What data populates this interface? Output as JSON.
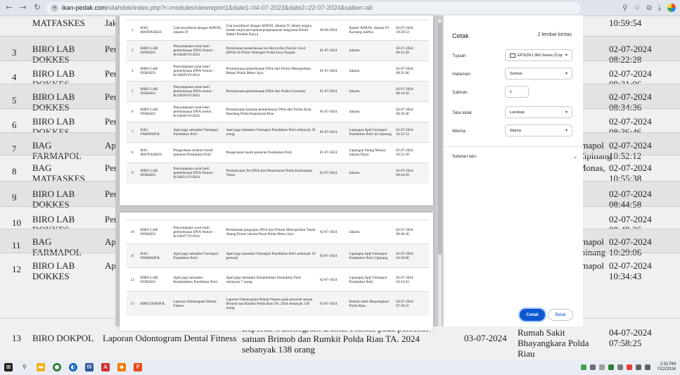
{
  "browser": {
    "url_host": "ikan-pedak.com",
    "url_path": "/silahdok/index.php?r=modules/viewreport1&date1=04-07-2023&date2=22-07-2024&satker=all",
    "icons": [
      "back-icon",
      "forward-icon",
      "reload-icon",
      "site-settings-icon",
      "zoom-icon",
      "bookmark-star-icon",
      "extensions-icon",
      "download-icon"
    ]
  },
  "background_table": {
    "rows": [
      {
        "no": "",
        "unit": "MATFASKES",
        "stub": "Jak",
        "loc": "",
        "date": "10:59:54"
      },
      {
        "no": "3",
        "unit": "BIRO LAB DOKKES",
        "stub": "Per DN",
        "loc": "",
        "date": "02-07-2024 08:22:28"
      },
      {
        "no": "4",
        "unit": "BIRO LAB DOKKES",
        "stub": "Per DN",
        "loc": "",
        "date": "02-07-2024 08:31:06"
      },
      {
        "no": "5",
        "unit": "BIRO LAB DOKKES",
        "stub": "Per DN",
        "loc": "",
        "date": "02-07-2024 08:34:36"
      },
      {
        "no": "6",
        "unit": "BIRO LAB DOKKES",
        "stub": "Per DN",
        "loc": "",
        "date": "02-07-2024 08:36:46"
      },
      {
        "no": "7",
        "unit": "BAG FARMAPOL",
        "stub": "Ap Pus",
        "loc": "rmapol Cipinang",
        "date": "02-07-2024 10:52:12"
      },
      {
        "no": "8",
        "unit": "BAG MATFASKES",
        "stub": "Per Pus",
        "loc": "Monas,",
        "date": "02-07-2024 10:55:38"
      },
      {
        "no": "9",
        "unit": "BIRO LAB DOKKES",
        "stub": "Per DN",
        "loc": "",
        "date": "02-07-2024 08:44:58"
      },
      {
        "no": "10",
        "unit": "BIRO LAB DOKKES",
        "stub": "Per DN",
        "loc": "",
        "date": "02-07-2024 08:48:36"
      },
      {
        "no": "11",
        "unit": "BAG FARMAPOL",
        "stub": "Ap Pus",
        "loc": "rmapol ipinang",
        "date": "02-07-2024 10:29:06"
      },
      {
        "no": "12",
        "unit": "BIRO LAB DOKKES",
        "stub": "Ap Pus",
        "loc": "rmapol",
        "date": "02-07-2024 10:34:43"
      }
    ],
    "last_row": {
      "no": "13",
      "unit": "BIRO DOKPOL",
      "kegiatan": "Laporan Odontogram Dental Fitness",
      "desc": "Laporan Odontogram Dental Fitness pada personel satuan Brimob dan Rumkit Polda Riau TA. 2024 sebanyak 138 orang",
      "tgl": "03-07-2024",
      "loc": "Rumah Sakit Bhayangkara Polda Riau",
      "date": "04-07-2024 07:58:25"
    }
  },
  "preview": {
    "page1_rows": [
      {
        "no": "2",
        "unit": "BAG MATFASKES",
        "keg": "Giat koordinasi dengan KPKNL Jakarta IV",
        "desc": "Giat koordinasi dengan KPKNL Jakarta IV dalam rangka tindak lanjut percepatan penghapusan bangunan Klinik Satkes Pondok Karya",
        "tgl": "28-06-2024",
        "loc": "Kantor KPKNL Jakarta IV- Kwitang JakPus",
        "ts": "02-07-2024 10:59:54"
      },
      {
        "no": "3",
        "unit": "BIRO LAB DOKKES",
        "keg": "Penyampaian surat hasil pemeriksaan DNA Nomor : R/24048/VI/2024",
        "desc": "Permintaan pemeriksaan tes Deoxyribo Nucleic Acid (DNA) di Polres Wonogiri Polda Jawa Tengah",
        "tgl": "01-07-2024",
        "loc": "Jakarta",
        "ts": "02-07-2024 08:22:28"
      },
      {
        "no": "4",
        "unit": "BIRO LAB DOKKES",
        "keg": "Penyampaian surat hasil pemeriksaan DNA Nomor : R/24049/VI/2024",
        "desc": "Permohonan pemeriksaan DNA dari Polres Metropolitan Bekasi Polda Metro Jaya",
        "tgl": "01-07-2024",
        "loc": "Jakarta",
        "ts": "02-07-2024 08:31:06"
      },
      {
        "no": "5",
        "unit": "BIRO LAB DOKKES",
        "keg": "Penyampaian surat hasil pemeriksaan DNA nomor : R/24050/VI/2024",
        "desc": "Permohonan pemeriksaan DNA dari Polda Gorontalo",
        "tgl": "01-07-2024",
        "loc": "Jakarta",
        "ts": "02-07-2024 08:34:36"
      },
      {
        "no": "6",
        "unit": "BIRO LAB DOKKES",
        "keg": "Penyampaian surat hasil pemeriksaan DNA nomor : R/24046/VI/2024",
        "desc": "Permohonan bantuan pemeriksaan DNA dari Polres Kota Barelang Polda Kepulauan Riau",
        "tgl": "01-07-2024",
        "loc": "Jakarta",
        "ts": "02-07-2024 08:36:46"
      },
      {
        "no": "7",
        "unit": "BAG FARMAPOL",
        "keg": "Apel pagi subsatker Farmapol Pusdokkes Polri",
        "desc": "Apel pagi subsatker Farmapol Pusdokkes Polri sebanyak 20 orang",
        "tgl": "01-07-2024",
        "loc": "Lapangan Apel Farmapol Pusdokkes Polri di Cipinang",
        "ts": "02-07-2024 10:52:12"
      },
      {
        "no": "8",
        "unit": "BAG MATFASKES",
        "keg": "Pengecekan terakhir booth pameran Pusdokkes Polri",
        "desc": "Pengecekan booth pameran Pusdokkes Polri",
        "tgl": "01-07-2024",
        "loc": "Lapangan Silang Monas, Jakarta Pusat",
        "ts": "02-07-2024 10:55:38"
      },
      {
        "no": "9",
        "unit": "BIRO LAB DOKKES",
        "keg": "Penyampaian surat hasil pemeriksaan DNA Nomor : R/24051/VI/2024",
        "desc": "Permohonan Tes DNA dari Reskrimum Polda Kalimantan Timur",
        "tgl": "02-07-2024",
        "loc": "Jakarta",
        "ts": "02-07-2024 08:44:58"
      }
    ],
    "page2_rows": [
      {
        "no": "10",
        "unit": "BIRO LAB DOKKES",
        "keg": "Penyampaian surat hasil pemeriksaan DNA Nomor : R/24047/VI/2024",
        "desc": "Permintaan pengujian DNA dari Polsek Metropolitan Tanah Abang Polres Jakarta Pusat Polda Metro Jaya",
        "tgl": "02-07-2024",
        "loc": "Jakarta",
        "ts": "02-07-2024 08:48:36"
      },
      {
        "no": "11",
        "unit": "BAG FARMAPOL",
        "keg": "Apel pagi subsatker Farmapol Pusdokkes Polri",
        "desc": "Apel pagi subsatker Farmapol Pusdokkes Polri sebanyak 10 personil",
        "tgl": "02-07-2024",
        "loc": "Lapangan Apel Farmapol Pusdokkes Polri Cipinang",
        "ts": "02-07-2024 10:29:06"
      },
      {
        "no": "12",
        "unit": "BIRO LAB DOKKES",
        "keg": "Apel pagi subsatker Rolabdokkes Pusdokkes Polri",
        "desc": "Apel pagi subsatker Rolabdokkes Pusdokkes Polri sebanyak 7 orang",
        "tgl": "02-07-2024",
        "loc": "Lapangan Apel Farmapol Pusdokkes Polri",
        "ts": "02-07-2024 10:34:43"
      },
      {
        "no": "13",
        "unit": "BIRO DOKPOL",
        "keg": "Laporan Odontogram Dental Fitness",
        "desc": "Laporan Odontogram Dental Fitness pada personel satuan Brimob dan Rumkit Polda Riau TA. 2024 sebanyak 138 orang",
        "tgl": "03-07-2024",
        "loc": "Rumah Sakit Bhayangkara Polda Riau",
        "ts": "04-07-2024 07:58:25"
      }
    ]
  },
  "print_panel": {
    "title": "Cetak",
    "sheet_count": "2 lembar kertas",
    "destination_label": "Tujuan",
    "destination_value": "EPSON L360 Series (Cop",
    "pages_label": "Halaman",
    "pages_value": "Semua",
    "copies_label": "Salinan",
    "copies_value": "1",
    "layout_label": "Tata letak",
    "layout_value": "Lanskap",
    "color_label": "Warna",
    "color_value": "Warna",
    "more_settings_label": "Setelan lain",
    "print_button": "Cetak",
    "cancel_button": "Batal",
    "accent": "#0b57d0"
  },
  "taskbar": {
    "time": "2:32 PM",
    "date": "7/22/2024"
  }
}
